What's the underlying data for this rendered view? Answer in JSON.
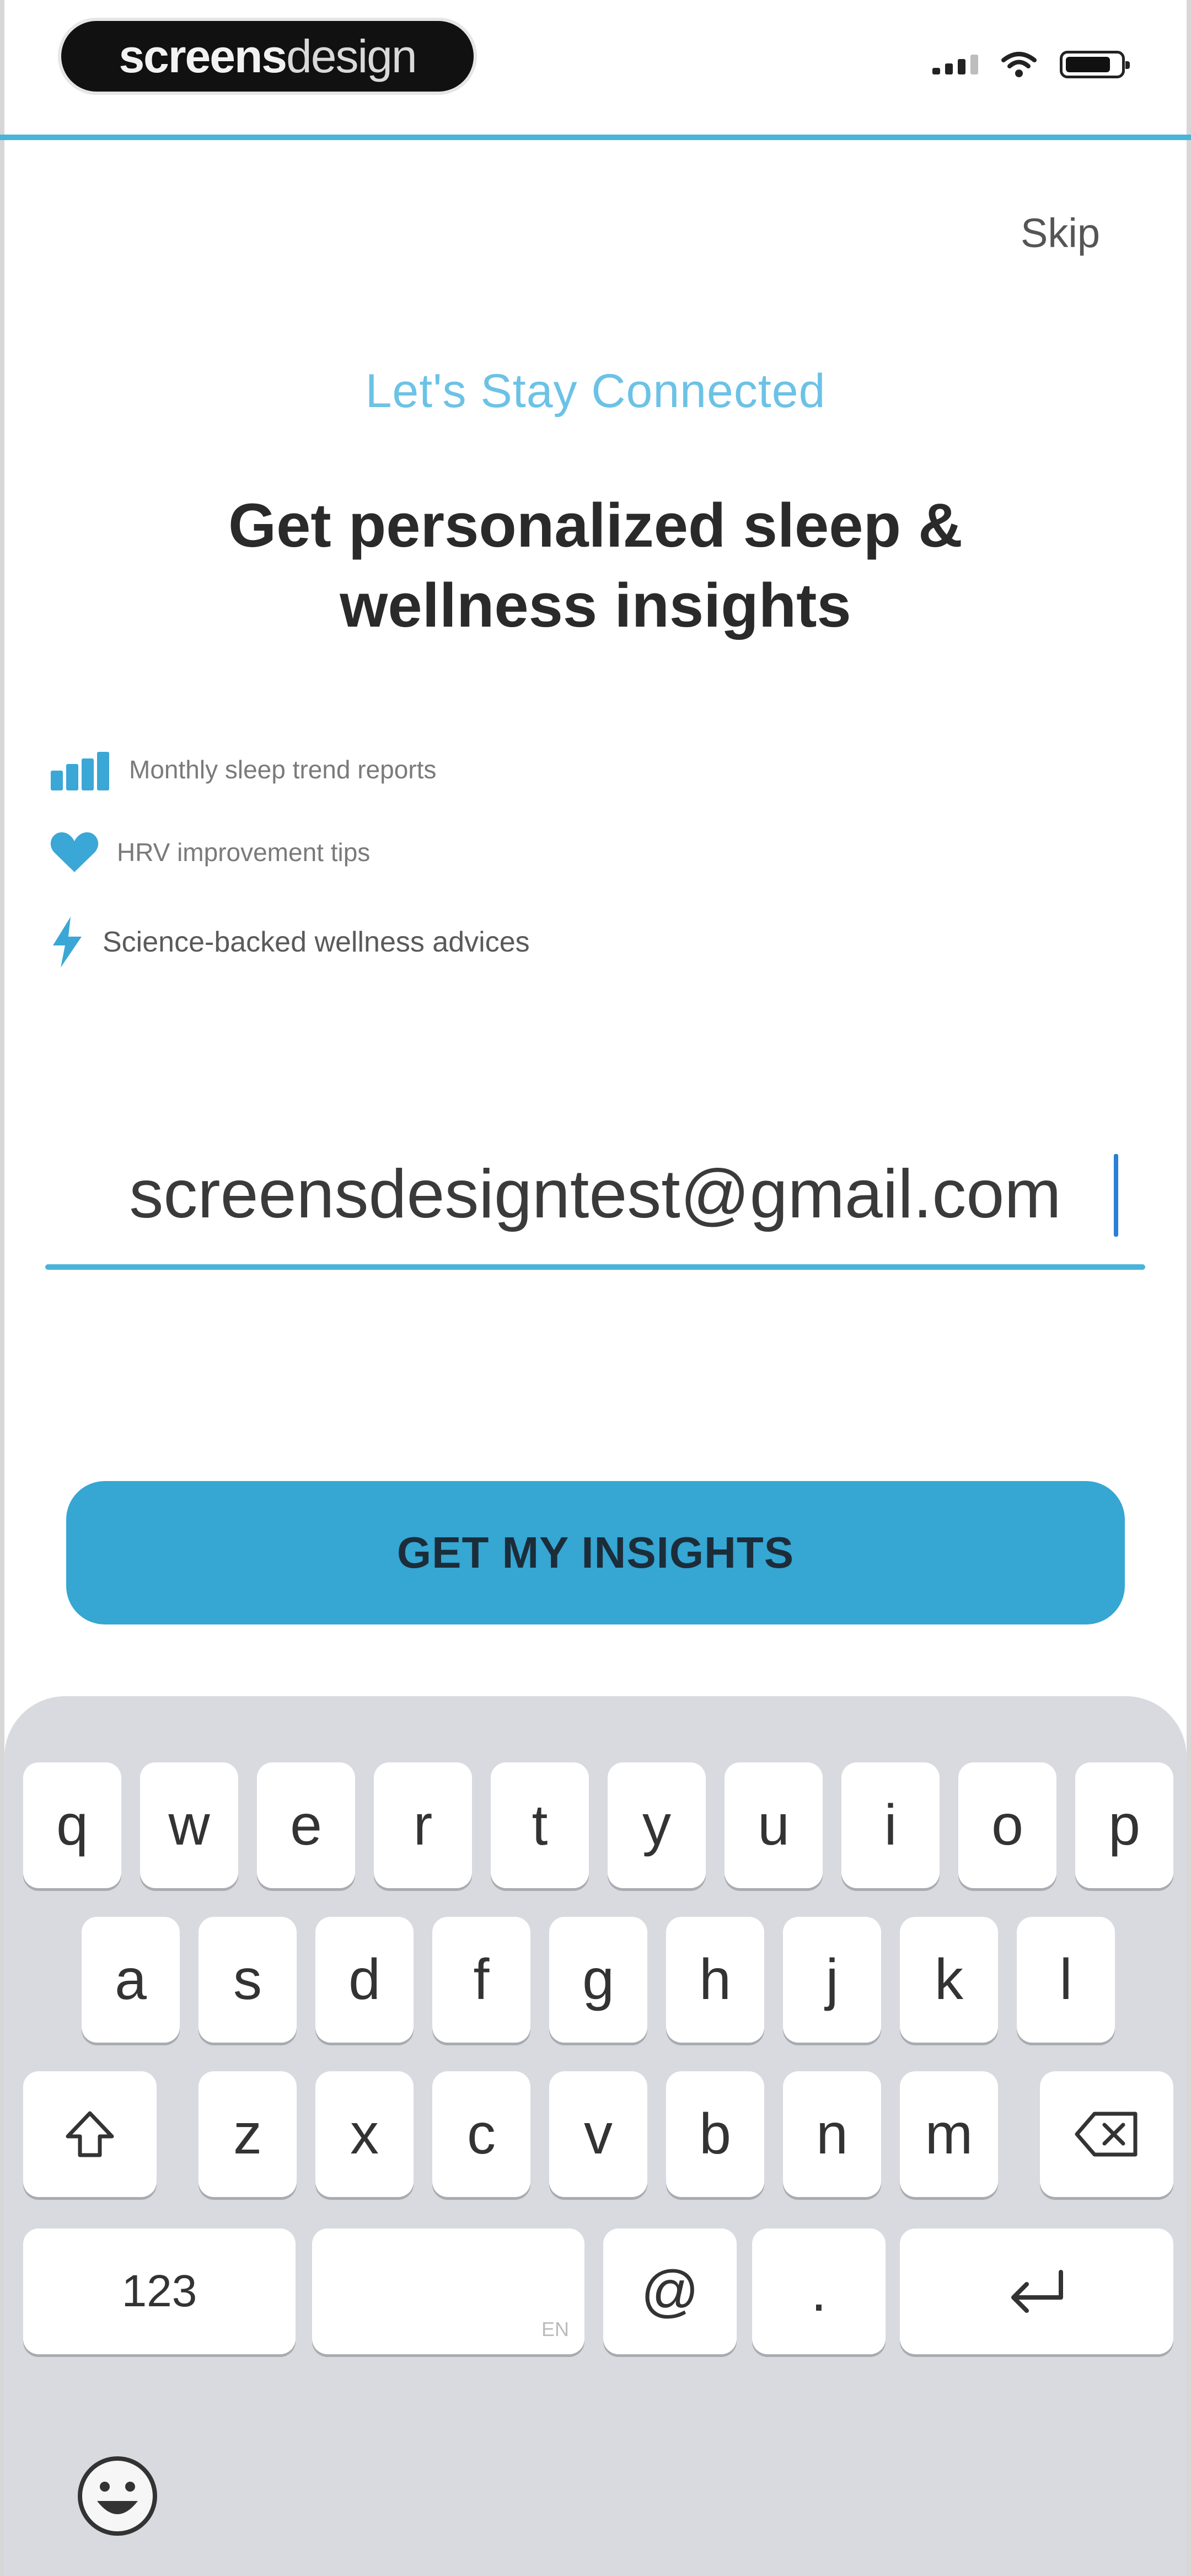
{
  "status_bar": {
    "brand_part1": "screens",
    "brand_part2": "design"
  },
  "header": {
    "skip_label": "Skip"
  },
  "content": {
    "subheading": "Let's Stay Connected",
    "headline_line1": "Get personalized sleep &",
    "headline_line2": "wellness insights",
    "features": [
      {
        "icon": "bar-chart-icon",
        "label": "Monthly sleep trend reports"
      },
      {
        "icon": "heart-icon",
        "label": "HRV improvement tips"
      },
      {
        "icon": "lightning-icon",
        "label": "Science-backed wellness advices"
      }
    ]
  },
  "email": {
    "value": "screensdesigntest@gmail.com"
  },
  "cta": {
    "label": "GET MY INSIGHTS"
  },
  "keyboard": {
    "row1": [
      "q",
      "w",
      "e",
      "r",
      "t",
      "y",
      "u",
      "i",
      "o",
      "p"
    ],
    "row2": [
      "a",
      "s",
      "d",
      "f",
      "g",
      "h",
      "j",
      "k",
      "l"
    ],
    "row3": [
      "z",
      "x",
      "c",
      "v",
      "b",
      "n",
      "m"
    ],
    "numbers_label": "123",
    "space_hint": "EN",
    "at_label": "@",
    "dot_label": ".",
    "emoji_icon": "emoji-icon",
    "shift_icon": "shift-icon",
    "delete_icon": "delete-icon",
    "return_icon": "return-icon"
  },
  "colors": {
    "accent": "#49b4da",
    "button": "#36a6d3",
    "subheading": "#6cc2e6"
  }
}
